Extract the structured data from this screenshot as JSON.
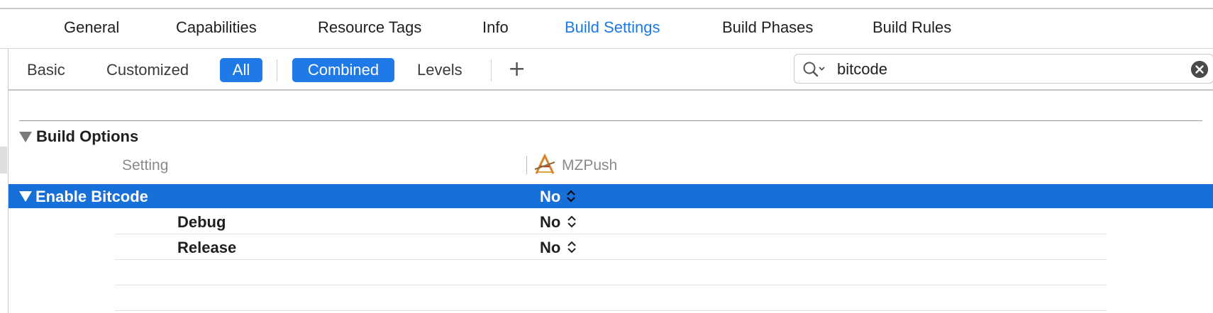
{
  "tabs": [
    {
      "label": "General",
      "active": false
    },
    {
      "label": "Capabilities",
      "active": false
    },
    {
      "label": "Resource Tags",
      "active": false
    },
    {
      "label": "Info",
      "active": false
    },
    {
      "label": "Build Settings",
      "active": true
    },
    {
      "label": "Build Phases",
      "active": false
    },
    {
      "label": "Build Rules",
      "active": false
    }
  ],
  "filters": {
    "basic": "Basic",
    "customized": "Customized",
    "all": "All",
    "combined": "Combined",
    "levels": "Levels",
    "add": "+"
  },
  "search": {
    "value": "bitcode",
    "icon": "magnifier-dropdown-icon",
    "clear_icon": "clear-icon"
  },
  "section": {
    "title": "Build Options",
    "columns": {
      "setting": "Setting",
      "target": "MZPush"
    }
  },
  "settings": [
    {
      "name": "Enable Bitcode",
      "value": "No",
      "selected": true,
      "rows": [
        {
          "config": "Debug",
          "value": "No"
        },
        {
          "config": "Release",
          "value": "No"
        }
      ]
    }
  ],
  "colors": {
    "accent": "#1b7ae0",
    "selection": "#1670d8",
    "button_selected": "#1f7ae8"
  }
}
